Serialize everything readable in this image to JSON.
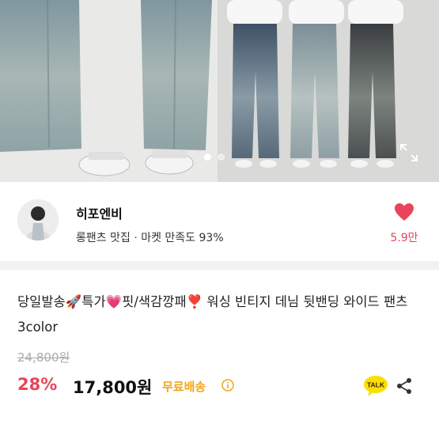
{
  "seller": {
    "name": "히포엔비",
    "tagline": "롱팬츠 맛집",
    "rating_text": "마켓 만족도 93%",
    "likes": "5.9만"
  },
  "product": {
    "title": "당일발송🚀특가💗핏/색감깡패❣️ 워싱 빈티지 데님 뒷밴딩 와이드 팬츠 3color",
    "original_price": "24,800원",
    "discount": "28%",
    "price": "17,800원",
    "shipping": "무료배송"
  },
  "talk_label": "TALK",
  "carousel": {
    "count": 2,
    "active": 0
  },
  "colors": {
    "accent_red": "#e8455a",
    "shipping_orange": "#f2a51a",
    "kakao_yellow": "#f9e000"
  },
  "icons": {
    "like": "heart-icon",
    "info": "info-icon",
    "talk": "kakao-talk-icon",
    "share": "share-icon",
    "expand": "expand-icon"
  }
}
